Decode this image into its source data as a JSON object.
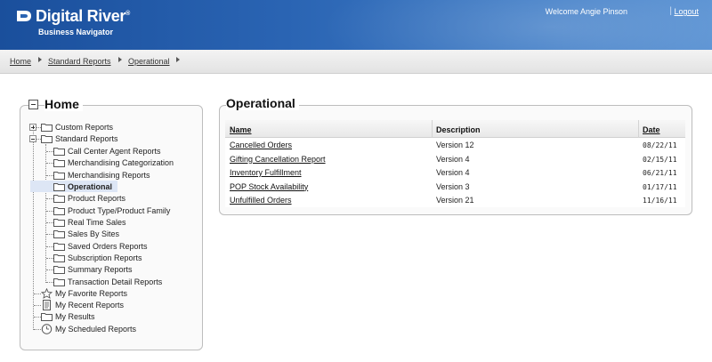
{
  "header": {
    "brand": "Digital River",
    "brand_mark": "®",
    "subtitle": "Business Navigator",
    "welcome": "Welcome Angie Pinson",
    "separator": "|",
    "logout": "Logout",
    "colors": {
      "header_dark": "#1a4f9c",
      "header_light": "#5a92d3"
    }
  },
  "breadcrumb": [
    "Home",
    "Standard Reports",
    "Operational"
  ],
  "left": {
    "title": "Home",
    "tree": [
      {
        "label": "Custom Reports",
        "icon": "folder-icon",
        "expander": "plus"
      },
      {
        "label": "Standard Reports",
        "icon": "folder-icon",
        "expander": "minus",
        "children": [
          "Call Center Agent Reports",
          "Merchandising Categorization",
          "Merchandising Reports",
          "Operational",
          "Product Reports",
          "Product Type/Product Family",
          "Real Time Sales",
          "Sales By Sites",
          "Saved Orders Reports",
          "Subscription Reports",
          "Summary Reports",
          "Transaction Detail Reports"
        ],
        "selected": "Operational"
      },
      {
        "label": "My Favorite Reports",
        "icon": "star-icon"
      },
      {
        "label": "My Recent Reports",
        "icon": "document-icon"
      },
      {
        "label": "My Results",
        "icon": "folder-icon"
      },
      {
        "label": "My Scheduled Reports",
        "icon": "clock-icon"
      }
    ]
  },
  "main": {
    "title": "Operational",
    "columns": [
      "Name",
      "Description",
      "Date"
    ],
    "rows": [
      {
        "name": "Cancelled Orders",
        "description": "Version 12",
        "date": "08/22/11"
      },
      {
        "name": "Gifting Cancellation Report",
        "description": "Version 4",
        "date": "02/15/11"
      },
      {
        "name": "Inventory Fulfillment",
        "description": "Version 4",
        "date": "06/21/11"
      },
      {
        "name": "POP Stock Availability",
        "description": "Version 3",
        "date": "01/17/11"
      },
      {
        "name": "Unfulfilled Orders",
        "description": "Version 21",
        "date": "11/16/11"
      }
    ]
  }
}
